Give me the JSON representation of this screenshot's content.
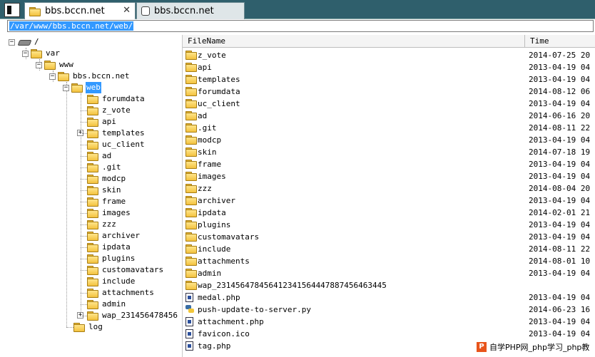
{
  "tabs": [
    {
      "label": "bbs.bccn.net",
      "active": true,
      "close": "✕"
    },
    {
      "label": "bbs.bccn.net",
      "active": false
    }
  ],
  "address": {
    "value": "/var/www/bbs.bccn.net/web/"
  },
  "tree": {
    "root": "/",
    "var": "var",
    "www": "www",
    "site": "bbs.bccn.net",
    "web": "web",
    "children": [
      "forumdata",
      "z_vote",
      "api",
      "templates",
      "uc_client",
      "ad",
      ".git",
      "modcp",
      "skin",
      "frame",
      "images",
      "zzz",
      "archiver",
      "ipdata",
      "plugins",
      "customavatars",
      "include",
      "attachments",
      "admin",
      "wap_231456478456"
    ],
    "log": "log"
  },
  "list": {
    "columns": {
      "name": "FileName",
      "time": "Time"
    },
    "rows": [
      {
        "name": "z_vote",
        "time": "2014-07-25 20",
        "icon": "folder"
      },
      {
        "name": "api",
        "time": "2013-04-19 04",
        "icon": "folder"
      },
      {
        "name": "templates",
        "time": "2013-04-19 04",
        "icon": "folder"
      },
      {
        "name": "forumdata",
        "time": "2014-08-12 06",
        "icon": "folder"
      },
      {
        "name": "uc_client",
        "time": "2013-04-19 04",
        "icon": "folder"
      },
      {
        "name": "ad",
        "time": "2014-06-16 20",
        "icon": "folder"
      },
      {
        "name": ".git",
        "time": "2014-08-11 22",
        "icon": "folder"
      },
      {
        "name": "modcp",
        "time": "2013-04-19 04",
        "icon": "folder"
      },
      {
        "name": "skin",
        "time": "2014-07-18 19",
        "icon": "folder"
      },
      {
        "name": "frame",
        "time": "2013-04-19 04",
        "icon": "folder"
      },
      {
        "name": "images",
        "time": "2013-04-19 04",
        "icon": "folder"
      },
      {
        "name": "zzz",
        "time": "2014-08-04 20",
        "icon": "folder"
      },
      {
        "name": "archiver",
        "time": "2013-04-19 04",
        "icon": "folder"
      },
      {
        "name": "ipdata",
        "time": "2014-02-01 21",
        "icon": "folder"
      },
      {
        "name": "plugins",
        "time": "2013-04-19 04",
        "icon": "folder"
      },
      {
        "name": "customavatars",
        "time": "2013-04-19 04",
        "icon": "folder"
      },
      {
        "name": "include",
        "time": "2014-08-11 22",
        "icon": "folder"
      },
      {
        "name": "attachments",
        "time": "2014-08-01 10",
        "icon": "folder"
      },
      {
        "name": "admin",
        "time": "2013-04-19 04",
        "icon": "folder"
      },
      {
        "name": "wap_231456478456412341564447887456463445",
        "time": "",
        "icon": "folder"
      },
      {
        "name": "medal.php",
        "time": "2013-04-19 04",
        "icon": "file"
      },
      {
        "name": "push-update-to-server.py",
        "time": "2014-06-23 16",
        "icon": "python"
      },
      {
        "name": "attachment.php",
        "time": "2013-04-19 04",
        "icon": "file"
      },
      {
        "name": "favicon.ico",
        "time": "2013-04-19 04",
        "icon": "file"
      },
      {
        "name": "tag.php",
        "time": "",
        "icon": "file"
      }
    ]
  },
  "watermark": {
    "logo": "P",
    "text": "自学PHP网_php学习_php教"
  },
  "colors": {
    "tabbar": "#2f5f6c",
    "selection": "#3399ff",
    "folder": "#f3c23f"
  }
}
